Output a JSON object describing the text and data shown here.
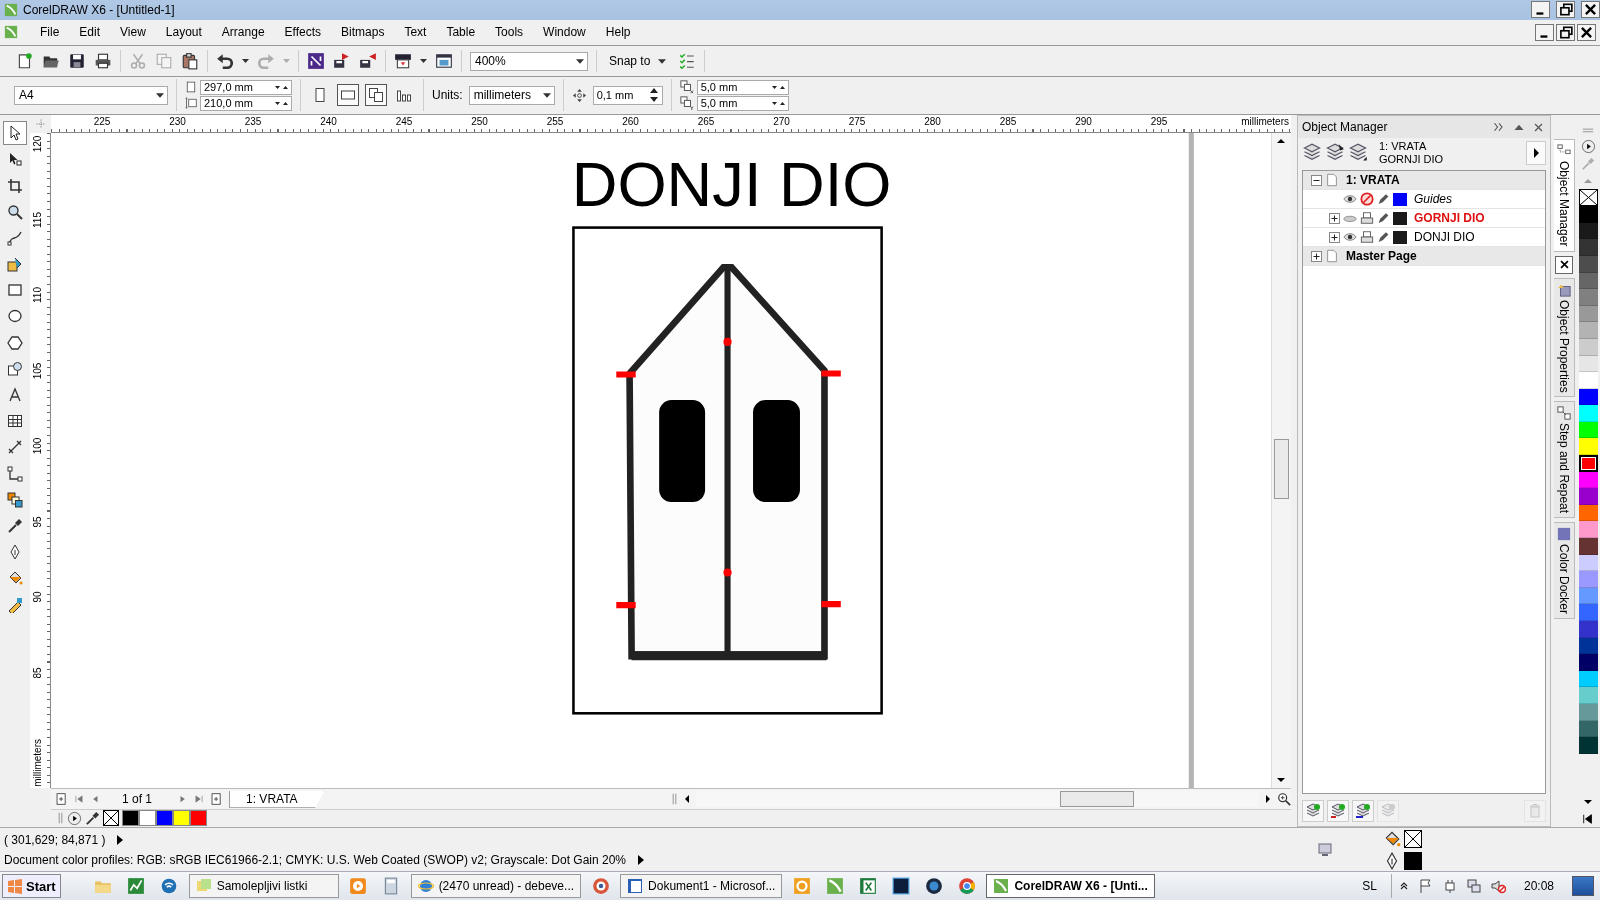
{
  "window": {
    "title": "CorelDRAW X6 - [Untitled-1]"
  },
  "menu": [
    "File",
    "Edit",
    "View",
    "Layout",
    "Arrange",
    "Effects",
    "Bitmaps",
    "Text",
    "Table",
    "Tools",
    "Window",
    "Help"
  ],
  "toolbar": [
    [
      {
        "kind": "new",
        "disabled": false
      },
      {
        "kind": "open",
        "disabled": false
      },
      {
        "kind": "save",
        "disabled": false
      },
      {
        "kind": "print",
        "disabled": false
      }
    ],
    [
      {
        "kind": "cut",
        "disabled": true
      },
      {
        "kind": "copy",
        "disabled": true
      },
      {
        "kind": "paste",
        "disabled": false
      }
    ],
    [
      {
        "kind": "undo",
        "disabled": false
      },
      {
        "kind": "dropdown",
        "disabled": false
      },
      {
        "kind": "redo",
        "disabled": true
      },
      {
        "kind": "dropdown",
        "disabled": true
      }
    ],
    [
      {
        "kind": "launcher",
        "disabled": false
      },
      {
        "kind": "import",
        "disabled": false
      },
      {
        "kind": "export",
        "disabled": false
      }
    ],
    [
      {
        "kind": "publish",
        "disabled": false
      },
      {
        "kind": "dropdown",
        "disabled": false
      },
      {
        "kind": "welcome",
        "disabled": false
      }
    ],
    [
      {
        "kind": "zoom_field",
        "value": "400%"
      }
    ],
    [
      {
        "kind": "snap_menu",
        "label": "Snap to"
      },
      {
        "kind": "options",
        "disabled": false
      }
    ]
  ],
  "property_bar": {
    "page_size": "A4",
    "page_width": "297,0 mm",
    "page_height": "210,0 mm",
    "buttons": [
      {
        "kind": "portrait",
        "selected": false
      },
      {
        "kind": "landscape",
        "selected": true
      },
      {
        "kind": "all_pages",
        "selected": true
      },
      {
        "kind": "current_page",
        "selected": false
      }
    ],
    "units_label": "Units:",
    "units": "millimeters",
    "nudge": "0,1 mm",
    "duplicate_x": "5,0 mm",
    "duplicate_y": "5,0 mm"
  },
  "toolbox": [
    {
      "kind": "pick",
      "selected": true
    },
    {
      "kind": "shape",
      "selected": false
    },
    {
      "kind": "crop",
      "selected": false
    },
    {
      "kind": "zoom",
      "selected": false
    },
    {
      "kind": "freehand",
      "selected": false
    },
    {
      "kind": "smart_fill",
      "selected": false
    },
    {
      "kind": "rectangle",
      "selected": false
    },
    {
      "kind": "ellipse",
      "selected": false
    },
    {
      "kind": "polygon",
      "selected": false
    },
    {
      "kind": "basic_shapes",
      "selected": false
    },
    {
      "kind": "text",
      "selected": false
    },
    {
      "kind": "table",
      "selected": false
    },
    {
      "kind": "dimension",
      "selected": false
    },
    {
      "kind": "connector",
      "selected": false
    },
    {
      "kind": "blend",
      "selected": false
    },
    {
      "kind": "eyedropper",
      "selected": false
    },
    {
      "kind": "outline",
      "selected": false
    },
    {
      "kind": "fill",
      "selected": false
    },
    {
      "kind": "interactive_fill",
      "selected": false
    }
  ],
  "rulers": {
    "horizontal": [
      "225",
      "230",
      "235",
      "240",
      "245",
      "250",
      "255",
      "260",
      "265",
      "270",
      "275",
      "280",
      "285",
      "290",
      "295"
    ],
    "horizontal_unit": "millimeters",
    "vertical": [
      "120",
      "115",
      "110",
      "105",
      "100",
      "95",
      "90",
      "85"
    ],
    "vertical_unit": "millimeters"
  },
  "canvas": {
    "title": "DONJI DIO"
  },
  "page_nav": {
    "position": "1 of 1",
    "tab": "1: VRATA"
  },
  "document_palette": [
    {
      "color": "#000000"
    },
    {
      "color": "#ffffff"
    },
    {
      "color": "#0000ff"
    },
    {
      "color": "#ffff00"
    },
    {
      "color": "#ff0000"
    }
  ],
  "object_manager": {
    "title": "Object Manager",
    "current_page": "1: VRATA",
    "current_layer": "GORNJI DIO",
    "tree": [
      {
        "label": "1: VRATA",
        "expanded": true,
        "children": [
          {
            "label": "Guides",
            "visible": true,
            "printable": false,
            "color": "#0000ff",
            "active": false
          },
          {
            "label": "GORNJI DIO",
            "expanded": false,
            "visible": false,
            "printable": true,
            "color": "#1a1a1a",
            "active": true
          },
          {
            "label": "DONJI DIO",
            "expanded": false,
            "visible": true,
            "printable": true,
            "color": "#1a1a1a",
            "active": false
          }
        ]
      },
      {
        "label": "Master Page",
        "expanded": false
      }
    ],
    "buttons": [
      {
        "kind": "new_layer",
        "disabled": false
      },
      {
        "kind": "new_master_layer",
        "disabled": false
      },
      {
        "kind": "new_master_layer_all",
        "disabled": false
      },
      {
        "kind": "new_master_layer_odd",
        "disabled": true
      },
      {
        "kind": "delete",
        "disabled": true
      }
    ]
  },
  "docker_tabs": [
    {
      "label": "Object Manager",
      "selected": true
    },
    {
      "label": "Object Properties",
      "selected": false
    },
    {
      "label": "Step and Repeat",
      "selected": false
    },
    {
      "label": "Color Docker",
      "selected": false
    }
  ],
  "color_palette": [
    {
      "color": "#000000",
      "selected": false
    },
    {
      "color": "#1a1a1a",
      "selected": false
    },
    {
      "color": "#333333",
      "selected": false
    },
    {
      "color": "#4d4d4d",
      "selected": false
    },
    {
      "color": "#666666",
      "selected": false
    },
    {
      "color": "#808080",
      "selected": false
    },
    {
      "color": "#999999",
      "selected": false
    },
    {
      "color": "#b3b3b3",
      "selected": false
    },
    {
      "color": "#cccccc",
      "selected": false
    },
    {
      "color": "#e6e6e6",
      "selected": false
    },
    {
      "color": "#ffffff",
      "selected": false
    },
    {
      "color": "#0000ff",
      "selected": false
    },
    {
      "color": "#00ffff",
      "selected": false
    },
    {
      "color": "#00ff00",
      "selected": false
    },
    {
      "color": "#ffff00",
      "selected": false
    },
    {
      "color": "#ff0000",
      "selected": true
    },
    {
      "color": "#ff00ff",
      "selected": false
    },
    {
      "color": "#9900cc",
      "selected": false
    },
    {
      "color": "#ff6600",
      "selected": false
    },
    {
      "color": "#ff99cc",
      "selected": false
    },
    {
      "color": "#663333",
      "selected": false
    },
    {
      "color": "#ccccff",
      "selected": false
    },
    {
      "color": "#9999ff",
      "selected": false
    },
    {
      "color": "#6699ff",
      "selected": false
    },
    {
      "color": "#3366ff",
      "selected": false
    },
    {
      "color": "#3333cc",
      "selected": false
    },
    {
      "color": "#003399",
      "selected": false
    },
    {
      "color": "#000066",
      "selected": false
    },
    {
      "color": "#00ccff",
      "selected": false
    },
    {
      "color": "#66cccc",
      "selected": false
    },
    {
      "color": "#669999",
      "selected": false
    },
    {
      "color": "#336666",
      "selected": false
    },
    {
      "color": "#003333",
      "selected": false
    }
  ],
  "status": {
    "coordinates": "( 301,629; 84,871 )",
    "color_profiles": "Document color profiles: RGB: sRGB IEC61966-2.1; CMYK: U.S. Web Coated (SWOP) v2; Grayscale: Dot Gain 20%"
  },
  "taskbar": {
    "items": [
      {
        "kind": "start",
        "label": "Start"
      },
      {
        "kind": "icon"
      },
      {
        "kind": "icon"
      },
      {
        "kind": "icon"
      },
      {
        "kind": "window",
        "label": "Samolepljivi listki",
        "selected": false
      },
      {
        "kind": "icon"
      },
      {
        "kind": "icon"
      },
      {
        "kind": "window",
        "label": "(2470 unread) - debeve...",
        "selected": false
      },
      {
        "kind": "icon"
      },
      {
        "kind": "window",
        "label": "Dokument1 - Microsof...",
        "selected": false
      },
      {
        "kind": "icon"
      },
      {
        "kind": "icon"
      },
      {
        "kind": "icon"
      },
      {
        "kind": "icon"
      },
      {
        "kind": "icon"
      },
      {
        "kind": "icon"
      },
      {
        "kind": "window",
        "label": "CorelDRAW X6 - [Unti...",
        "selected": true
      }
    ],
    "language": "SL",
    "time": "20:08"
  }
}
